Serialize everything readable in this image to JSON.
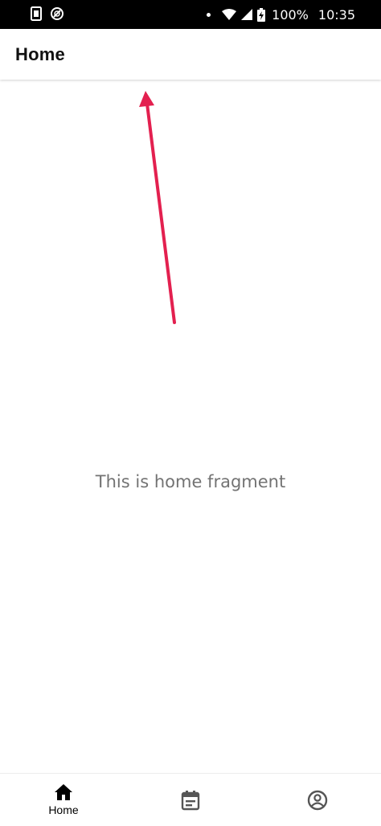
{
  "status_bar": {
    "battery": "100%",
    "time": "10:35"
  },
  "app_bar": {
    "title": "Home"
  },
  "content": {
    "message": "This is home fragment"
  },
  "bottom_nav": {
    "items": [
      {
        "label": "Home",
        "icon": "home-icon",
        "selected": true
      },
      {
        "label": "",
        "icon": "calendar-icon",
        "selected": false
      },
      {
        "label": "",
        "icon": "account-circle-icon",
        "selected": false
      }
    ]
  },
  "colors": {
    "annotation_arrow": "#e3204f",
    "status_bar_bg": "#000000",
    "message_text": "#737373"
  }
}
